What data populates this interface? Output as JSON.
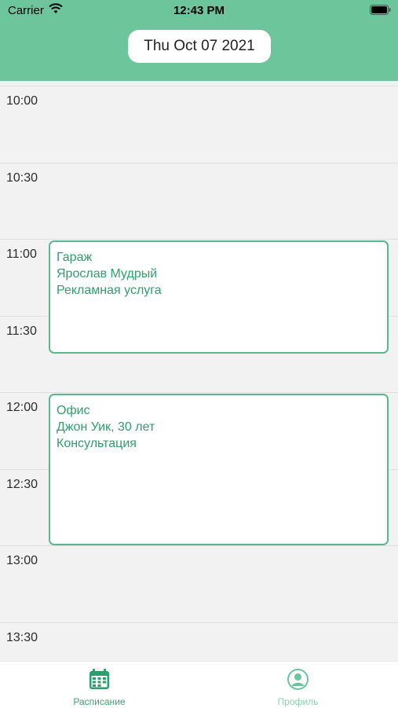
{
  "status_bar": {
    "carrier": "Carrier",
    "time": "12:43 PM"
  },
  "header": {
    "date": "Thu Oct 07 2021"
  },
  "timeline": {
    "slots": [
      "10:00",
      "10:30",
      "11:00",
      "11:30",
      "12:00",
      "12:30",
      "13:00",
      "13:30"
    ],
    "events": [
      {
        "lines": [
          "Гараж",
          "Ярослав Мудрый",
          "Рекламная услуга"
        ]
      },
      {
        "lines": [
          "Офис",
          "Джон Уик, 30 лет",
          "Консультация"
        ]
      }
    ]
  },
  "tabbar": {
    "tabs": [
      {
        "label": "Расписание",
        "icon": "calendar-icon",
        "active": true
      },
      {
        "label": "Профиль",
        "icon": "profile-icon",
        "active": false
      }
    ]
  },
  "colors": {
    "header": "#6dc69b",
    "accent": "#2f9e6c",
    "event_border": "#59b98c",
    "background": "#f2f2f2"
  }
}
